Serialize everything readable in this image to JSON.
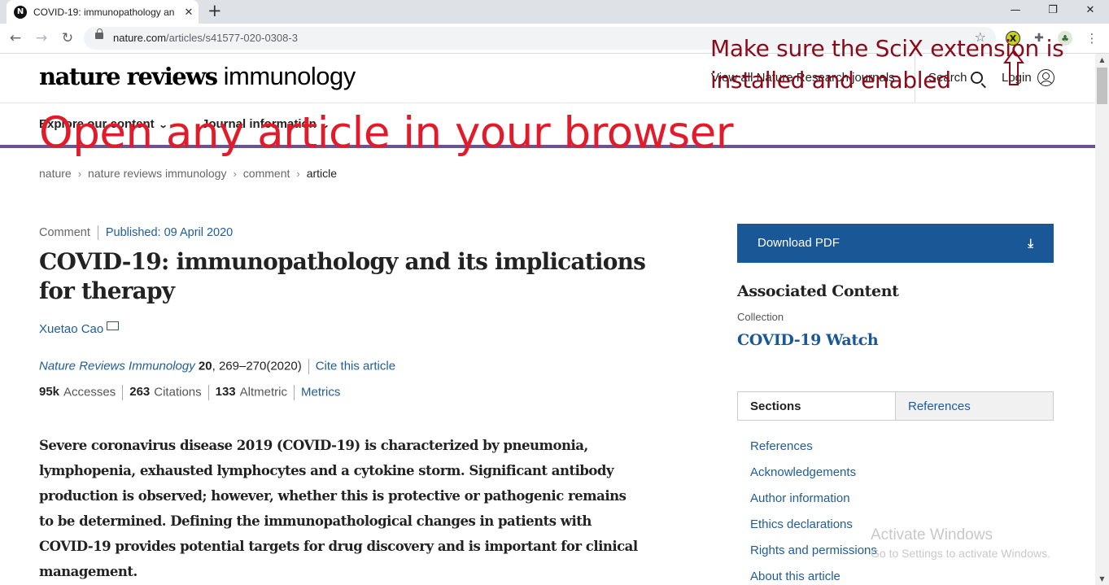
{
  "browser": {
    "tab_title": "COVID-19: immunopathology an",
    "tab_favicon": "N",
    "url_domain": "nature.com",
    "url_path": "/articles/s41577-020-0308-3",
    "scix_label": "X"
  },
  "site": {
    "logo_bold": "nature reviews",
    "logo_light": " immunology",
    "view_all": "View all Nature Research journals",
    "search": "Search",
    "login": "Login",
    "nav": [
      "Explore our content",
      "Journal information"
    ]
  },
  "breadcrumbs": [
    "nature",
    "nature reviews immunology",
    "comment",
    "article"
  ],
  "article": {
    "type": "Comment",
    "published": "Published: 09 April 2020",
    "title": "COVID-19: immunopathology and its implications for therapy",
    "author": "Xuetao Cao",
    "journal": "Nature Reviews Immunology",
    "volume": "20",
    "pages": ", 269–270(2020)",
    "cite_link": "Cite this article",
    "accesses_value": "95k",
    "accesses_label": "Accesses",
    "citations_value": "263",
    "citations_label": "Citations",
    "altmetric_value": "133",
    "altmetric_label": "Altmetric",
    "metrics_link": "Metrics",
    "abstract": "Severe coronavirus disease 2019 (COVID-19) is characterized by pneumonia, lymphopenia, exhausted lymphocytes and a cytokine storm. Significant antibody production is observed; however, whether this is protective or pathogenic remains to be determined. Defining the immunopathological changes in patients with COVID-19 provides potential targets for drug discovery and is important for clinical management."
  },
  "sidebar": {
    "download": "Download PDF",
    "associated": "Associated Content",
    "collection": "Collection",
    "collection_title": "COVID-19 Watch",
    "tab_sections": "Sections",
    "tab_references": "References",
    "sections": [
      "References",
      "Acknowledgements",
      "Author information",
      "Ethics declarations",
      "Rights and permissions",
      "About this article"
    ]
  },
  "annotations": {
    "extension_note_line1": "Make sure the SciX extension is",
    "extension_note_line2": "installed and enabled",
    "open_article": "Open any article in your browser",
    "arrow_color": "#8a0b1a",
    "open_color": "#e21b2b"
  },
  "watermark": {
    "title": "Activate Windows",
    "subtitle": "Go to Settings to activate Windows."
  }
}
